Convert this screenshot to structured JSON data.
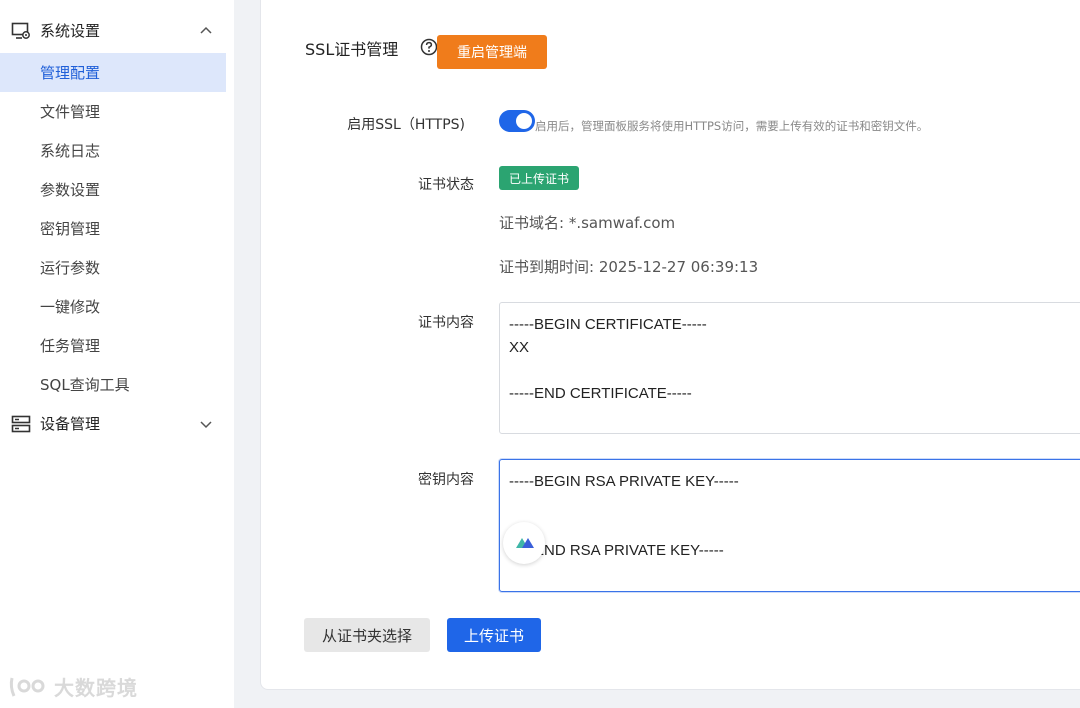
{
  "sidebar": {
    "system_group": {
      "label": "系统设置",
      "icon": "monitor-gear-icon",
      "expanded": true
    },
    "items": [
      {
        "label": "管理配置",
        "active": true
      },
      {
        "label": "文件管理"
      },
      {
        "label": "系统日志"
      },
      {
        "label": "参数设置"
      },
      {
        "label": "密钥管理"
      },
      {
        "label": "运行参数"
      },
      {
        "label": "一键修改"
      },
      {
        "label": "任务管理"
      },
      {
        "label": "SQL查询工具"
      }
    ],
    "device_group": {
      "label": "设备管理",
      "icon": "server-icon",
      "expanded": false
    }
  },
  "watermark": {
    "text": "大数跨境"
  },
  "ssl": {
    "title": "SSL证书管理",
    "restart_label": "重启管理端",
    "enable_label": "启用SSL（HTTPS)",
    "enable_hint": "启用后，管理面板服务将使用HTTPS访问，需要上传有效的证书和密钥文件。",
    "enabled": true,
    "status_label": "证书状态",
    "status_badge": "已上传证书",
    "domain_text": "证书域名: *.samwaf.com",
    "expiry_text": "证书到期时间: 2025-12-27 06:39:13",
    "cert_label": "证书内容",
    "cert_content": "-----BEGIN CERTIFICATE-----\nXX\n\n-----END CERTIFICATE-----",
    "key_label": "密钥内容",
    "key_content": "-----BEGIN RSA PRIVATE KEY-----\n\n\n-----END RSA PRIVATE KEY-----",
    "choose_label": "从证书夹选择",
    "upload_label": "上传证书"
  },
  "colors": {
    "accent": "#1f66e8",
    "warning": "#f07c1b",
    "success": "#2ba471"
  }
}
